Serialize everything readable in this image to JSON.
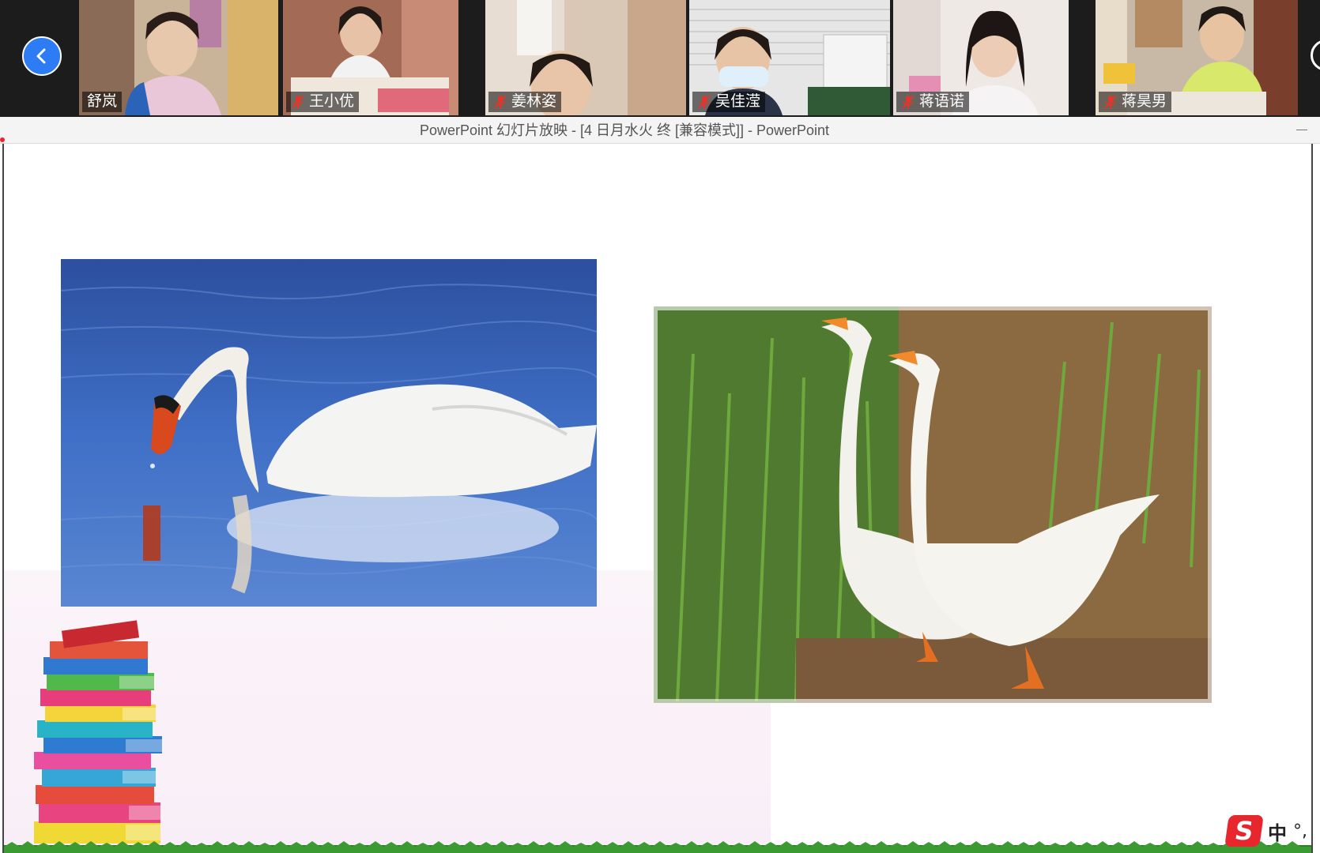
{
  "meeting": {
    "participants": [
      {
        "name": "舒岚",
        "muted": false
      },
      {
        "name": "王小优",
        "muted": true
      },
      {
        "name": "姜林姿",
        "muted": true
      },
      {
        "name": "吴佳滢",
        "muted": true
      },
      {
        "name": "蒋语诺",
        "muted": true
      },
      {
        "name": "蒋昊男",
        "muted": true
      }
    ]
  },
  "powerpoint": {
    "window_title": "PowerPoint 幻灯片放映 - [4 日月水火 终 [兼容模式]] - PowerPoint"
  },
  "ime": {
    "logo": "S",
    "mode": "中",
    "punct": "°,"
  },
  "icons": {
    "nav_prev": "chevron-left-icon",
    "mic": "mic-off-icon"
  },
  "colors": {
    "accent_blue": "#2d7cf6",
    "mic_off_red": "#e5352b",
    "ime_red": "#e8262d"
  }
}
